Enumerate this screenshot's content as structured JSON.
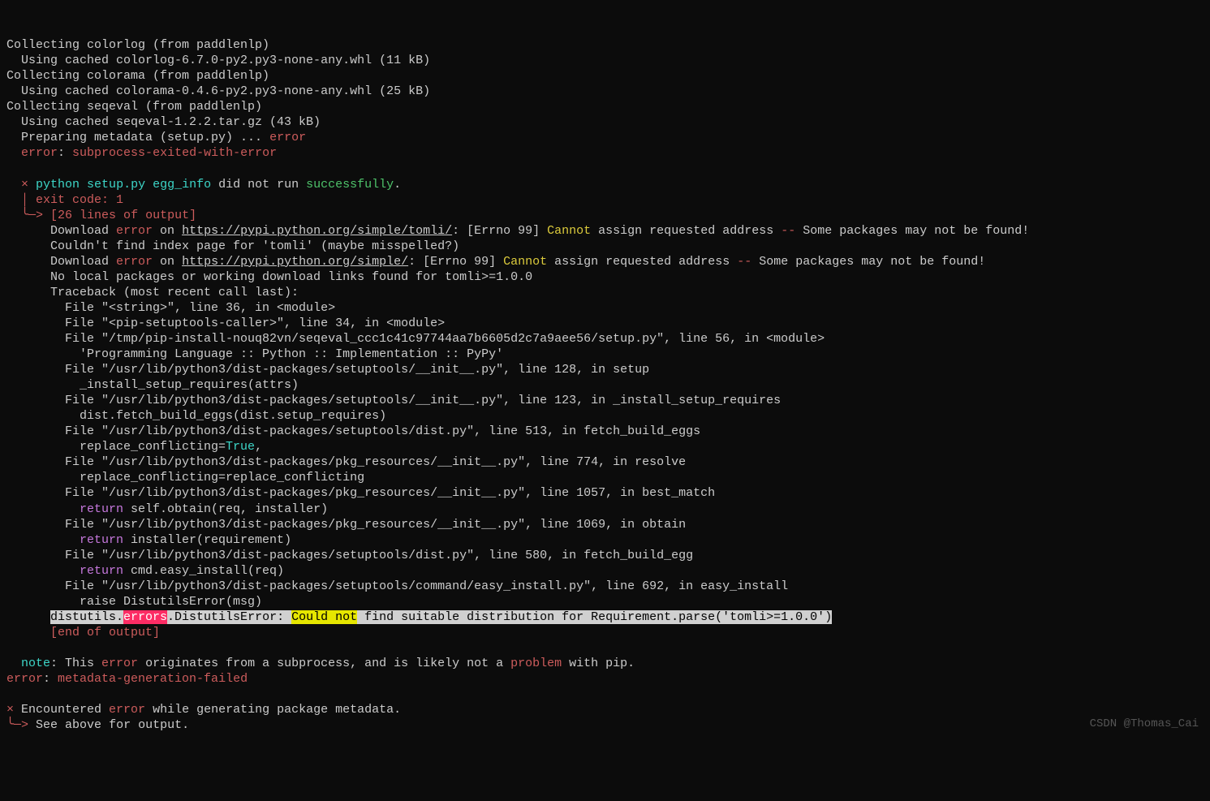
{
  "l1": "Collecting colorlog (from paddlenlp)",
  "l2": "  Using cached colorlog-6.7.0-py2.py3-none-any.whl (11 kB)",
  "l3": "Collecting colorama (from paddlenlp)",
  "l4": "  Using cached colorama-0.4.6-py2.py3-none-any.whl (25 kB)",
  "l5": "Collecting seqeval (from paddlenlp)",
  "l6": "  Using cached seqeval-1.2.2.tar.gz (43 kB)",
  "l7a": "  Preparing metadata (setup.py) ... ",
  "l7b": "error",
  "l8a": "  ",
  "l8b": "error",
  "l8c": ": ",
  "l8d": "subprocess-exited-with-error",
  "l10a": "  ",
  "l10x": "×",
  "l10b": " ",
  "l10c": "python setup.py egg_info",
  "l10d": " did not run ",
  "l10e": "successfully",
  "l10f": ".",
  "l11a": "  │ exit code: ",
  "l11b": "1",
  "l12a": "  ╰─> ",
  "l12b": "[26 lines of output]",
  "l13a": "      Download ",
  "l13b": "error",
  "l13c": " on ",
  "l13d": "https://pypi.python.org/simple/tomli/",
  "l13e": ": [Errno 99] ",
  "l13f": "Cannot",
  "l13g": " assign requested address ",
  "l13h": "--",
  "l13i": " Some packages may not be found!",
  "l14": "      Couldn't find index page for 'tomli' (maybe misspelled?)",
  "l15a": "      Download ",
  "l15b": "error",
  "l15c": " on ",
  "l15d": "https://pypi.python.org/simple/",
  "l15e": ": [Errno 99] ",
  "l15f": "Cannot",
  "l15g": " assign requested address ",
  "l15h": "--",
  "l15i": " Some packages may not be found!",
  "l16": "      No local packages or working download links found for tomli>=1.0.0",
  "l17": "      Traceback (most recent call last):",
  "l18": "        File \"<string>\", line 36, in <module>",
  "l19": "        File \"<pip-setuptools-caller>\", line 34, in <module>",
  "l20": "        File \"/tmp/pip-install-nouq82vn/seqeval_ccc1c41c97744aa7b6605d2c7a9aee56/setup.py\", line 56, in <module>",
  "l21": "          'Programming Language :: Python :: Implementation :: PyPy'",
  "l22": "        File \"/usr/lib/python3/dist-packages/setuptools/__init__.py\", line 128, in setup",
  "l23": "          _install_setup_requires(attrs)",
  "l24": "        File \"/usr/lib/python3/dist-packages/setuptools/__init__.py\", line 123, in _install_setup_requires",
  "l25": "          dist.fetch_build_eggs(dist.setup_requires)",
  "l26": "        File \"/usr/lib/python3/dist-packages/setuptools/dist.py\", line 513, in fetch_build_eggs",
  "l27a": "          replace_conflicting=",
  "l27b": "True",
  "l27c": ",",
  "l28": "        File \"/usr/lib/python3/dist-packages/pkg_resources/__init__.py\", line 774, in resolve",
  "l29": "          replace_conflicting=replace_conflicting",
  "l30": "        File \"/usr/lib/python3/dist-packages/pkg_resources/__init__.py\", line 1057, in best_match",
  "l31a": "          ",
  "l31b": "return",
  "l31c": " self.obtain(req, installer)",
  "l32": "        File \"/usr/lib/python3/dist-packages/pkg_resources/__init__.py\", line 1069, in obtain",
  "l33a": "          ",
  "l33b": "return",
  "l33c": " installer(requirement)",
  "l34": "        File \"/usr/lib/python3/dist-packages/setuptools/dist.py\", line 580, in fetch_build_egg",
  "l35a": "          ",
  "l35b": "return",
  "l35c": " cmd.easy_install(req)",
  "l36": "        File \"/usr/lib/python3/dist-packages/setuptools/command/easy_install.py\", line 692, in easy_install",
  "l37": "          raise DistutilsError(msg)",
  "l38a": "      ",
  "l38b": "distutils.",
  "l38c": "errors",
  "l38d": ".DistutilsError: ",
  "l38e": "Could not",
  "l38f": " find suitable distribution for Requirement.parse('tomli>=1.0.0')",
  "l39a": "      ",
  "l39b": "[end of output]",
  "l41a": "  ",
  "l41b": "note",
  "l41c": ": This ",
  "l41d": "error",
  "l41e": " originates from a subprocess, and is likely not a ",
  "l41f": "problem",
  "l41g": " with pip.",
  "l42a": "error",
  "l42b": ": ",
  "l42c": "metadata-generation-failed",
  "l44a": "×",
  "l44b": " Encountered ",
  "l44c": "error",
  "l44d": " while generating package metadata.",
  "l45a": "╰─>",
  "l45b": " See above for output.",
  "watermark": "CSDN @Thomas_Cai"
}
